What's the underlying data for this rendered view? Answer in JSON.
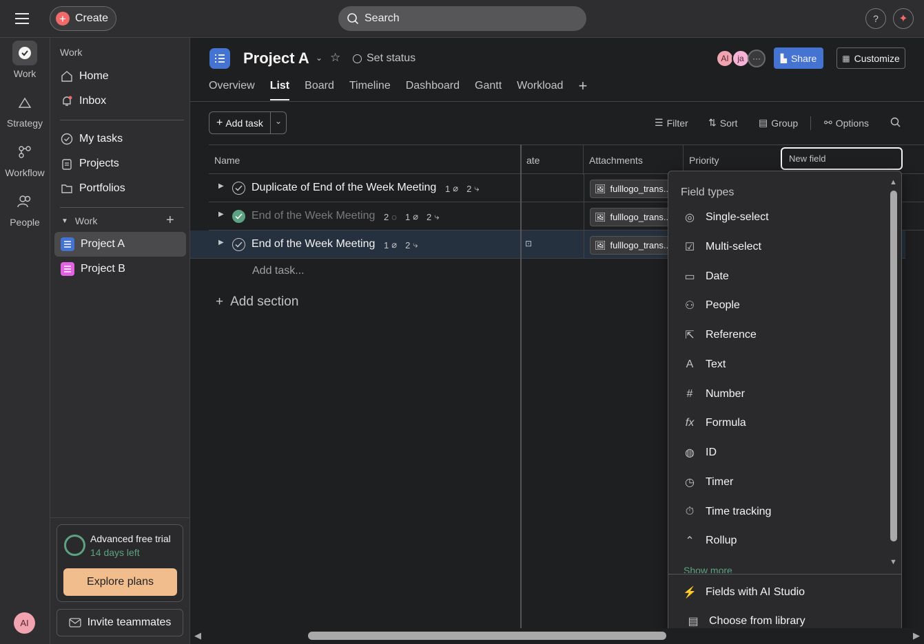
{
  "topbar": {
    "create_label": "Create",
    "search_placeholder": "Search",
    "help_label": "?"
  },
  "rail": {
    "items": [
      {
        "label": "Work"
      },
      {
        "label": "Strategy"
      },
      {
        "label": "Workflow"
      },
      {
        "label": "People"
      }
    ],
    "avatar": "AI"
  },
  "sidebar": {
    "section_label": "Work",
    "nav": [
      {
        "label": "Home"
      },
      {
        "label": "Inbox"
      }
    ],
    "my": [
      {
        "label": "My tasks"
      },
      {
        "label": "Projects"
      },
      {
        "label": "Portfolios"
      }
    ],
    "team_label": "Work",
    "projects": [
      {
        "label": "Project A",
        "color": "#4573d2"
      },
      {
        "label": "Project B",
        "color": "#e362e3"
      }
    ],
    "trial_title": "Advanced free trial",
    "trial_days": "14 days left",
    "explore_label": "Explore plans",
    "invite_label": "Invite teammates"
  },
  "project": {
    "title": "Project A",
    "set_status": "Set status",
    "tabs": [
      {
        "label": "Overview"
      },
      {
        "label": "List"
      },
      {
        "label": "Board"
      },
      {
        "label": "Timeline"
      },
      {
        "label": "Dashboard"
      },
      {
        "label": "Gantt"
      },
      {
        "label": "Workload"
      }
    ],
    "avatars": [
      "AI",
      "ja"
    ],
    "share_label": "Share",
    "customize_label": "Customize"
  },
  "toolbar": {
    "add_task": "Add task",
    "filter": "Filter",
    "sort": "Sort",
    "group": "Group",
    "options": "Options"
  },
  "table": {
    "columns": [
      "Name",
      "ate",
      "Attachments",
      "Priority"
    ],
    "new_field_placeholder": "New field",
    "rows": [
      {
        "name": "Duplicate of End of the Week Meeting",
        "attach_count": "1",
        "subtask_count": "2",
        "comment_count": "",
        "attachment": "fulllogo_trans..."
      },
      {
        "name": "End of the Week Meeting",
        "attach_count": "1",
        "subtask_count": "2",
        "comment_count": "2",
        "attachment": "fulllogo_trans..."
      },
      {
        "name": "End of the Week Meeting",
        "attach_count": "1",
        "subtask_count": "2",
        "comment_count": "",
        "attachment": "fulllogo_trans..."
      }
    ],
    "add_task_placeholder": "Add task...",
    "add_section": "Add section"
  },
  "field_types": {
    "title": "Field types",
    "items": [
      {
        "label": "Single-select",
        "icon": "circle-check-icon"
      },
      {
        "label": "Multi-select",
        "icon": "square-check-icon"
      },
      {
        "label": "Date",
        "icon": "calendar-icon"
      },
      {
        "label": "People",
        "icon": "person-icon"
      },
      {
        "label": "Reference",
        "icon": "reference-icon"
      },
      {
        "label": "Text",
        "icon": "text-icon"
      },
      {
        "label": "Number",
        "icon": "hash-icon"
      },
      {
        "label": "Formula",
        "icon": "formula-icon"
      },
      {
        "label": "ID",
        "icon": "fingerprint-icon"
      },
      {
        "label": "Timer",
        "icon": "clock-icon"
      },
      {
        "label": "Time tracking",
        "icon": "stopwatch-icon"
      },
      {
        "label": "Rollup",
        "icon": "rollup-icon"
      }
    ],
    "show_more": "Show more",
    "ai_studio": "Fields with AI Studio",
    "library": "Choose from library"
  },
  "colors": {
    "accent": "#4573d2",
    "danger": "#f06a6a",
    "success": "#5da283",
    "trial_button": "#f1bd8c"
  }
}
